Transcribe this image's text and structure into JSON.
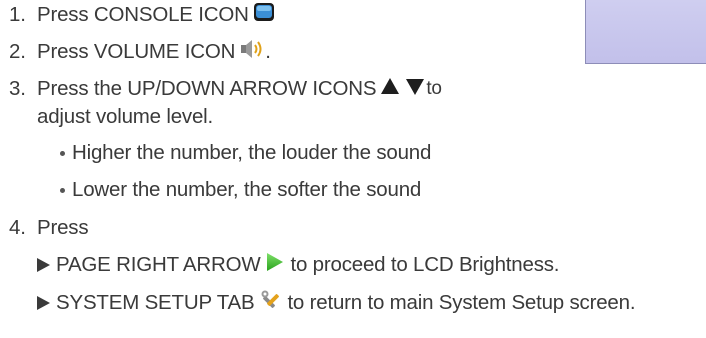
{
  "steps": [
    {
      "number": "1.",
      "text": "Press CONSOLE ICON",
      "icon": "console-icon",
      "trail": ""
    },
    {
      "number": "2.",
      "text": "Press VOLUME ICON",
      "icon": "volume-icon",
      "trail": "."
    },
    {
      "number": "3.",
      "text": "Press the UP/DOWN ARROW ICONS",
      "icon": "up-down-arrow-icons",
      "trail": " to",
      "continuation": "adjust volume level."
    },
    {
      "number": "4.",
      "text": "Press"
    }
  ],
  "bullets": [
    "Higher the number, the louder the sound",
    "Lower the number, the softer the sound"
  ],
  "actions": [
    {
      "prefix": "PAGE RIGHT ARROW",
      "icon": "page-right-arrow-icon",
      "suffix": "to proceed to LCD Brightness."
    },
    {
      "prefix": "SYSTEM SETUP TAB",
      "icon": "system-setup-tab-icon",
      "suffix": "to return to main System Setup screen."
    }
  ],
  "colors": {
    "text": "#3a3a3a",
    "console_icon": "#3b8fd6",
    "arrow_green": "#3cba2c",
    "panel": "#c6c5ec"
  }
}
